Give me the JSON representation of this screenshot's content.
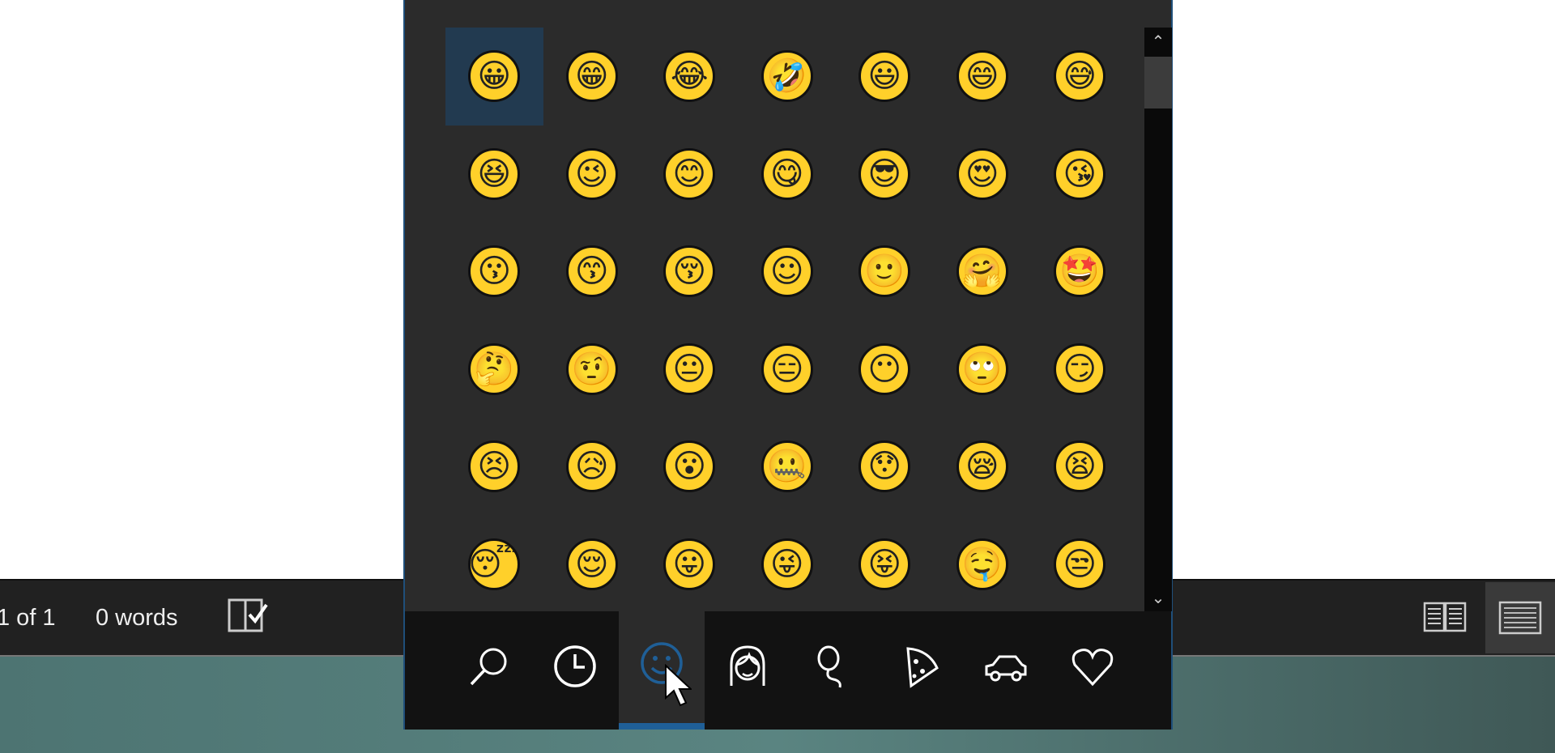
{
  "status_bar": {
    "page_info": "1 of 1",
    "word_count": "0 words",
    "proofing_icon": "book-check-icon",
    "view_buttons": [
      {
        "name": "read-mode",
        "icon": "open-book-icon"
      },
      {
        "name": "print-layout",
        "icon": "page-lines-icon",
        "active": true
      }
    ]
  },
  "emoji_panel": {
    "selected_index": 0,
    "emojis": [
      "😀",
      "😁",
      "😂",
      "🤣",
      "😃",
      "😄",
      "😅",
      "😆",
      "😉",
      "😊",
      "😋",
      "😎",
      "😍",
      "😘",
      "😗",
      "😙",
      "😚",
      "☺",
      "🙂",
      "🤗",
      "🤩",
      "🤔",
      "🤨",
      "😐",
      "😑",
      "😶",
      "🙄",
      "😏",
      "😣",
      "😥",
      "😮",
      "🤐",
      "😯",
      "😪",
      "😫",
      "😴",
      "😌",
      "😛",
      "😜",
      "😝",
      "🤤",
      "😒"
    ],
    "scrollbar": {
      "up": "^",
      "down": "v",
      "position": 0.0
    },
    "tabs": [
      {
        "name": "search",
        "icon": "search-icon"
      },
      {
        "name": "recent",
        "icon": "clock-icon"
      },
      {
        "name": "smileys",
        "icon": "smiley-icon",
        "active": true
      },
      {
        "name": "people",
        "icon": "person-icon"
      },
      {
        "name": "celebration",
        "icon": "balloon-icon"
      },
      {
        "name": "food",
        "icon": "pizza-icon"
      },
      {
        "name": "travel",
        "icon": "car-icon"
      },
      {
        "name": "symbols",
        "icon": "heart-icon"
      }
    ],
    "accent_color": "#1f5f97",
    "emoji_color": "#ffd02a"
  }
}
